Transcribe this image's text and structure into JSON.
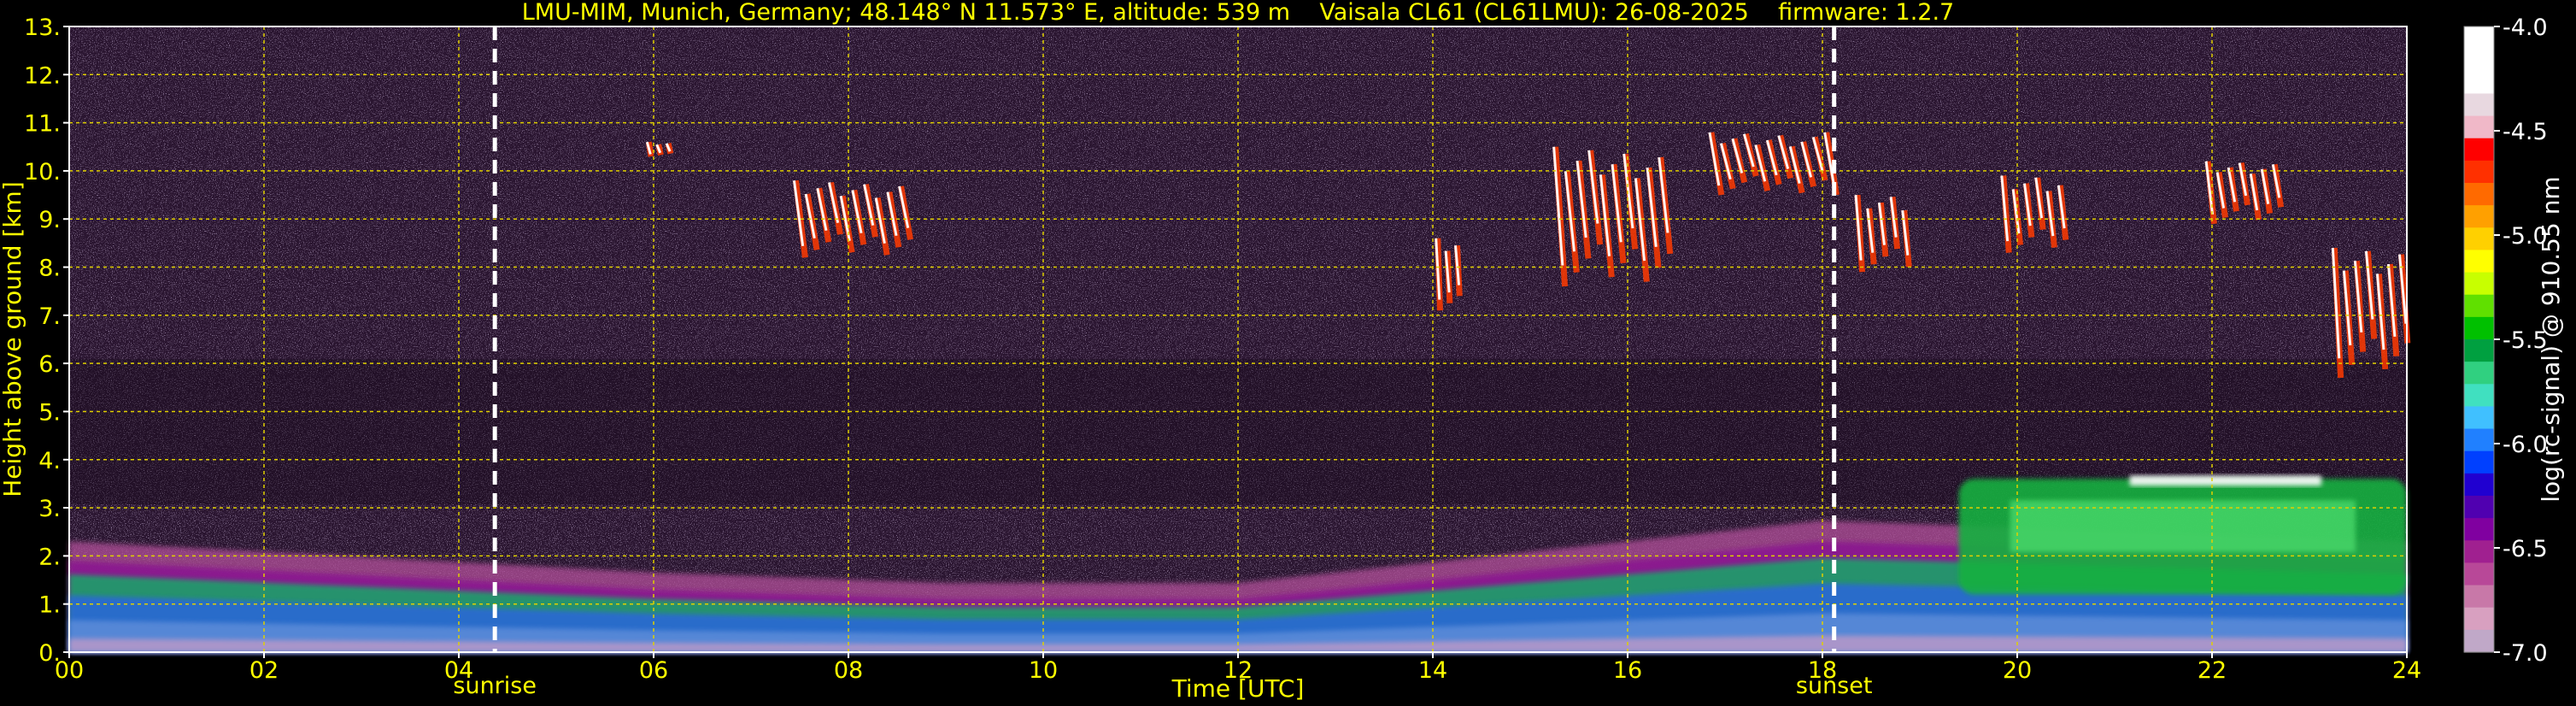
{
  "chart_data": {
    "type": "heatmap",
    "title": "LMU-MIM, Munich, Germany; 48.148° N 11.573° E, altitude: 539 m    Vaisala CL61 (CL61LMU): 26-08-2025    firmware: 1.2.7",
    "xlabel": "Time [UTC]",
    "ylabel": "Height above ground [km]",
    "xlim": [
      0,
      24
    ],
    "ylim": [
      0,
      13
    ],
    "x_ticks": [
      "00",
      "02",
      "04",
      "06",
      "08",
      "10",
      "12",
      "14",
      "16",
      "18",
      "20",
      "22",
      "24"
    ],
    "y_ticks": [
      "0.",
      "1.",
      "2.",
      "3.",
      "4.",
      "5.",
      "6.",
      "7.",
      "8.",
      "9.",
      "10.",
      "11.",
      "12.",
      "13."
    ],
    "grid": true,
    "markers": [
      {
        "label": "sunrise",
        "x_hours": 4.37
      },
      {
        "label": "sunset",
        "x_hours": 18.12
      }
    ],
    "colorbar": {
      "label": "log(rc-signal) @ 910.55 nm",
      "min": -7.0,
      "max": -4.0,
      "ticks": [
        "-4.0",
        "-4.5",
        "-5.0",
        "-5.5",
        "-6.0",
        "-6.5",
        "-7.0"
      ],
      "colors": [
        "#ffffff",
        "#ffffff",
        "#ffffff",
        "#e8d8e0",
        "#f0b8c8",
        "#ff0000",
        "#ff3000",
        "#ff6a00",
        "#ffa000",
        "#ffd000",
        "#ffff00",
        "#c8ff00",
        "#60e000",
        "#00c000",
        "#00a040",
        "#30d080",
        "#40e0c0",
        "#40c0ff",
        "#2080ff",
        "#0040ff",
        "#2000d0",
        "#5000b0",
        "#8000a0",
        "#a02090",
        "#b84898",
        "#c878a8",
        "#d8a0c0",
        "#c0a8c8"
      ]
    },
    "features": [
      {
        "type": "boundary_layer",
        "x_range": [
          0,
          24
        ],
        "top_km": [
          1.9,
          1.6,
          1.3,
          1.1,
          1.1,
          1.7,
          2.3,
          2.1,
          1.9
        ]
      },
      {
        "type": "residual_layer",
        "x_range": [
          19.4,
          24
        ],
        "y_range_km": [
          1.2,
          3.6
        ]
      },
      {
        "type": "cirrus",
        "x_range": [
          7.4,
          8.6
        ],
        "y_range_km": [
          8.2,
          9.8
        ]
      },
      {
        "type": "cirrus",
        "x_range": [
          15.2,
          16.4
        ],
        "y_range_km": [
          7.6,
          10.5
        ]
      },
      {
        "type": "cirrus",
        "x_range": [
          16.8,
          18.1
        ],
        "y_range_km": [
          9.5,
          10.8
        ]
      },
      {
        "type": "cirrus",
        "x_range": [
          18.3,
          18.9
        ],
        "y_range_km": [
          7.9,
          9.5
        ]
      },
      {
        "type": "cirrus",
        "x_range": [
          19.8,
          20.5
        ],
        "y_range_km": [
          8.3,
          9.9
        ]
      },
      {
        "type": "cirrus",
        "x_range": [
          21.9,
          22.7
        ],
        "y_range_km": [
          8.9,
          10.2
        ]
      },
      {
        "type": "cirrus",
        "x_range": [
          23.2,
          24
        ],
        "y_range_km": [
          5.7,
          8.4
        ]
      },
      {
        "type": "cirrus",
        "x_range": [
          14.0,
          14.3
        ],
        "y_range_km": [
          7.1,
          8.6
        ]
      },
      {
        "type": "cirrus",
        "x_range": [
          5.9,
          6.2
        ],
        "y_range_km": [
          10.3,
          10.6
        ]
      }
    ]
  }
}
